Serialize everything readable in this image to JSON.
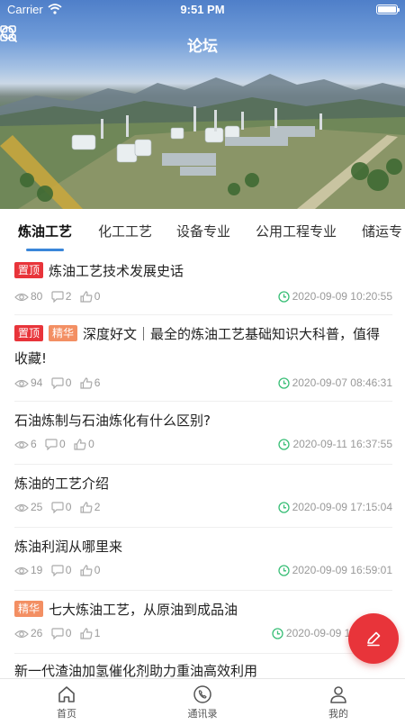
{
  "status_bar": {
    "carrier": "Carrier",
    "time": "9:51 PM"
  },
  "nav": {
    "title": "论坛",
    "left_icon": "grid-icon",
    "right_icon": "search-icon"
  },
  "tabs": [
    {
      "label": "炼油工艺",
      "active": true
    },
    {
      "label": "化工工艺",
      "active": false
    },
    {
      "label": "设备专业",
      "active": false
    },
    {
      "label": "公用工程专业",
      "active": false
    },
    {
      "label": "储运专",
      "active": false
    }
  ],
  "tags": {
    "top": "置顶",
    "best": "精华"
  },
  "posts": [
    {
      "title": "炼油工艺技术发展史话",
      "tags": [
        "top"
      ],
      "views": "80",
      "comments": "2",
      "likes": "0",
      "time": "2020-09-09 10:20:55"
    },
    {
      "title": "深度好文｜最全的炼油工艺基础知识大科普，值得收藏!",
      "tags": [
        "top",
        "best"
      ],
      "views": "94",
      "comments": "0",
      "likes": "6",
      "time": "2020-09-07 08:46:31"
    },
    {
      "title": "石油炼制与石油炼化有什么区别?",
      "tags": [],
      "views": "6",
      "comments": "0",
      "likes": "0",
      "time": "2020-09-11 16:37:55"
    },
    {
      "title": "炼油的工艺介绍",
      "tags": [],
      "views": "25",
      "comments": "0",
      "likes": "2",
      "time": "2020-09-09 17:15:04"
    },
    {
      "title": "炼油利润从哪里来",
      "tags": [],
      "views": "19",
      "comments": "0",
      "likes": "0",
      "time": "2020-09-09 16:59:01"
    },
    {
      "title": "七大炼油工艺，从原油到成品油",
      "tags": [
        "best"
      ],
      "views": "26",
      "comments": "0",
      "likes": "1",
      "time": "2020-09-09 16"
    },
    {
      "title": "新一代渣油加氢催化剂助力重油高效利用",
      "tags": [],
      "views": "",
      "comments": "",
      "likes": "",
      "time": ""
    }
  ],
  "fab": {
    "icon": "edit-pencil-icon"
  },
  "tab_bar": [
    {
      "label": "首页",
      "icon": "home-icon"
    },
    {
      "label": "通讯录",
      "icon": "phone-icon"
    },
    {
      "label": "我的",
      "icon": "person-icon"
    }
  ],
  "colors": {
    "accent": "#3a86d9",
    "tag_top": "#e8343a",
    "tag_best": "#f38f63",
    "fab": "#e8343a",
    "time_icon": "#3bbf78"
  }
}
